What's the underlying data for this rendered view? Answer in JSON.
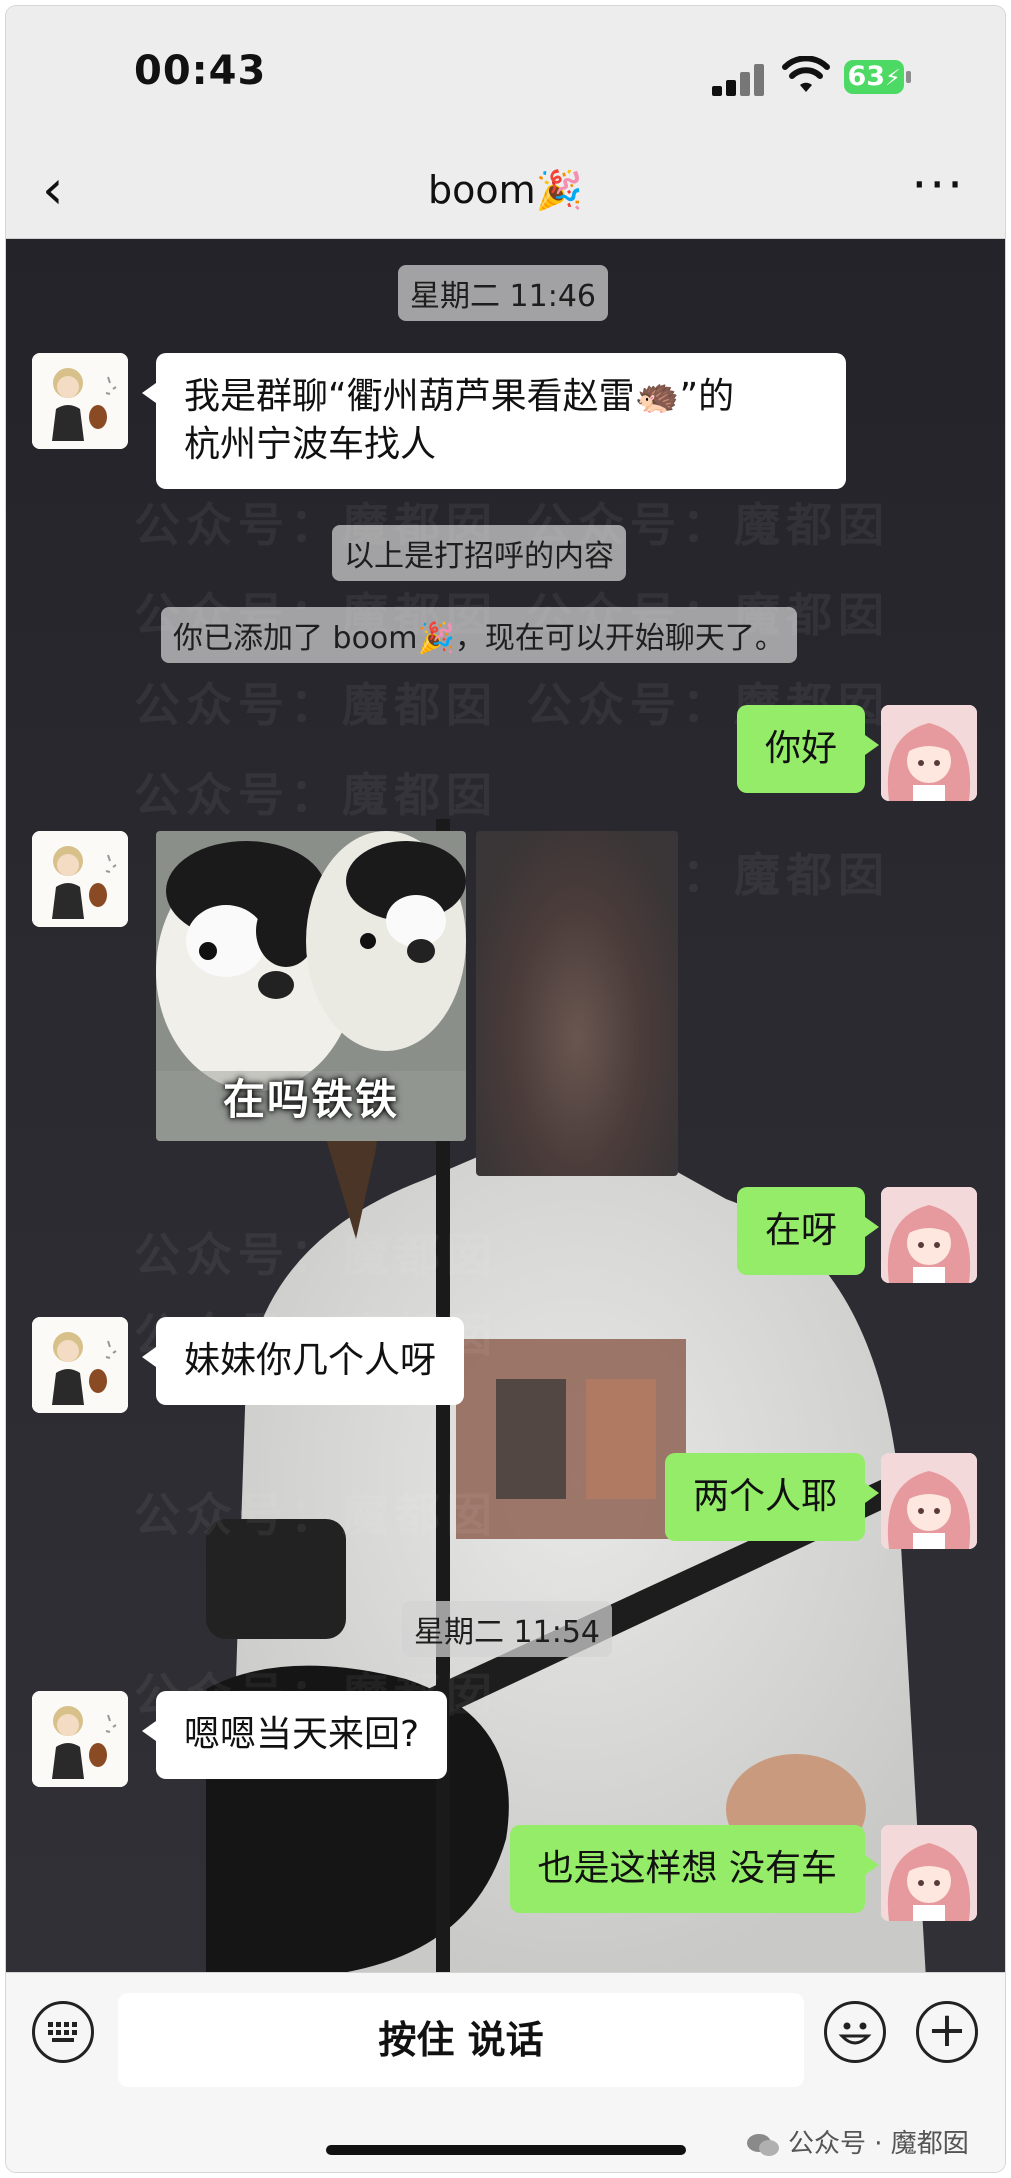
{
  "status_bar": {
    "time": "00:43",
    "battery": "63"
  },
  "nav": {
    "back_icon": "chevron-left",
    "title": "boom🎉",
    "more_icon": "ellipsis"
  },
  "watermark": "公众号：魔都囡",
  "timestamps": [
    "星期二 11:46",
    "星期二 11:54"
  ],
  "system_messages": [
    "以上是打招呼的内容",
    "你已添加了 boom🎉，现在可以开始聊天了。"
  ],
  "messages": [
    {
      "from": "other",
      "lines": [
        "我是群聊“衢州葫芦果看赵雷🦔”的",
        "杭州宁波车找人"
      ]
    },
    {
      "from": "me",
      "text": "你好"
    },
    {
      "from": "other",
      "type": "sticker",
      "caption": "在吗铁铁"
    },
    {
      "from": "me",
      "text": "在呀"
    },
    {
      "from": "other",
      "text": "妹妹你几个人呀"
    },
    {
      "from": "me",
      "text": "两个人耶"
    },
    {
      "from": "other",
      "text": "嗯嗯当天来回?"
    },
    {
      "from": "me",
      "text": "也是这样想 没有车"
    }
  ],
  "input_bar": {
    "hold_to_talk": "按住 说话",
    "keyboard_icon": "keyboard",
    "emoji_icon": "smile",
    "plus_icon": "plus"
  },
  "credit": "公众号 · 魔都囡",
  "colors": {
    "my_bubble": "#95ec69",
    "their_bubble": "#ffffff",
    "battery": "#4cd964",
    "nav_bg": "#ededed"
  }
}
